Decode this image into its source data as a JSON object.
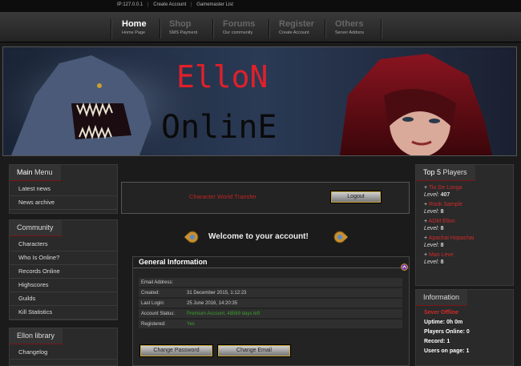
{
  "topbar": {
    "ip": "IP:127.0.0.1",
    "create_account": "Create Account",
    "gm_list": "Gamemaster List"
  },
  "nav": [
    {
      "title": "Home",
      "sub": "Home Page",
      "active": true
    },
    {
      "title": "Shop",
      "sub": "SMS Payment",
      "active": false
    },
    {
      "title": "Forums",
      "sub": "Our community",
      "active": false
    },
    {
      "title": "Register",
      "sub": "Create Account",
      "active": false
    },
    {
      "title": "Others",
      "sub": "Server Addons",
      "active": false
    }
  ],
  "banner": {
    "line1": "ElloN",
    "line2": "OnlinE"
  },
  "main_menu": {
    "title_a": "Main",
    "title_b": "Menu",
    "items": [
      "Latest news",
      "News archive"
    ]
  },
  "community": {
    "title": "Community",
    "items": [
      "Characters",
      "Who Is Online?",
      "Records Online",
      "Highscores",
      "Guilds",
      "Kill Statistics"
    ]
  },
  "library": {
    "title": "Ellon library",
    "items": [
      "Changelog"
    ]
  },
  "account": {
    "char_transfer": "Character World Transfer",
    "logout": "Logout",
    "welcome": "Welcome to your account!",
    "general_title": "General Information",
    "rows": [
      {
        "label": "Email Address:",
        "value": ""
      },
      {
        "label": "Created:",
        "value": "31 December 2015, 1:12:23"
      },
      {
        "label": "Last Login:",
        "value": "25 June 2016, 14:20:35"
      },
      {
        "label": "Account Status:",
        "value": "Premium Account, 48569 days left"
      },
      {
        "label": "Registered:",
        "value": "Yes"
      }
    ],
    "change_password": "Change Password",
    "change_email": "Change Email"
  },
  "top5": {
    "title_a": "Top 5",
    "title_b": "Players",
    "level_label": "Level:",
    "players": [
      {
        "name": "Tio De Longa",
        "level": "407"
      },
      {
        "name": "Rook Sample",
        "level": "8"
      },
      {
        "name": "ADM Ellon",
        "level": "8"
      },
      {
        "name": "Apachai Hopachai",
        "level": "8"
      },
      {
        "name": "Mao Leve",
        "level": "8"
      }
    ]
  },
  "information": {
    "title": "Information",
    "status": "Sever Offline",
    "uptime": "Uptime: 0h 0m",
    "players_online": "Players Online: 0",
    "record": "Record: 1",
    "users_on_page": "Users on page: 1"
  },
  "colors": {
    "accent_red": "#d02a2a",
    "status_green": "#3aa02a",
    "button_border": "#caa53a"
  }
}
